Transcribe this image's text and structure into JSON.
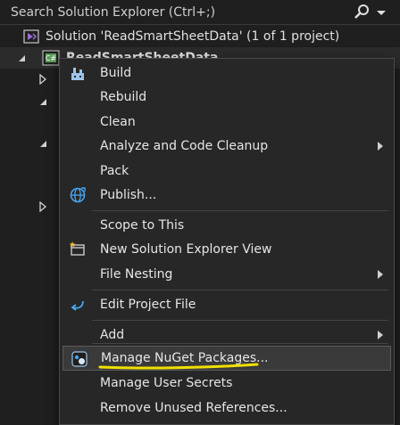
{
  "search": {
    "placeholder": "Search Solution Explorer (Ctrl+;)"
  },
  "tree": {
    "solution_label": "Solution 'ReadSmartSheetData' (1 of 1 project)",
    "project_label": "ReadSmartSheetData"
  },
  "menu": {
    "items": [
      {
        "label": "Build",
        "icon": "build-icon"
      },
      {
        "label": "Rebuild"
      },
      {
        "label": "Clean"
      },
      {
        "label": "Analyze and Code Cleanup",
        "submenu": true
      },
      {
        "label": "Pack"
      },
      {
        "label": "Publish...",
        "icon": "globe-icon"
      },
      {
        "label": "Scope to This"
      },
      {
        "label": "New Solution Explorer View",
        "icon": "new-view-icon"
      },
      {
        "label": "File Nesting",
        "submenu": true
      },
      {
        "label": "Edit Project File",
        "icon": "edit-project-icon"
      },
      {
        "label": "Add",
        "submenu": true
      },
      {
        "label": "Manage NuGet Packages...",
        "icon": "nuget-icon",
        "highlighted": true
      },
      {
        "label": "Manage User Secrets"
      },
      {
        "label": "Remove Unused References..."
      }
    ]
  },
  "colors": {
    "background": "#1f1f1f",
    "menu_background": "#272727",
    "highlight": "#3a3a3a",
    "annotation_underline": "#f0e000",
    "csharp_badge": "#5aa05a",
    "solution_icon": "#9b6fd0"
  }
}
